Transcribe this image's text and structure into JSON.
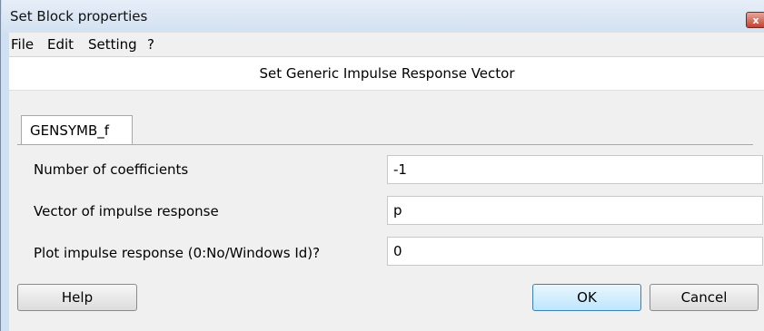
{
  "window": {
    "title": "Set Block properties",
    "close_glyph": "x"
  },
  "menu": {
    "items": [
      "File",
      "Edit",
      "Setting",
      "?"
    ]
  },
  "dialog": {
    "heading": "Set Generic Impulse Response Vector",
    "tab_label": "GENSYMB_f"
  },
  "fields": [
    {
      "label": "Number of coefficients",
      "value": "-1"
    },
    {
      "label": "Vector of impulse response",
      "value": "p"
    },
    {
      "label": "Plot impulse response (0:No/Windows Id)?",
      "value": "0"
    }
  ],
  "buttons": {
    "help": "Help",
    "ok": "OK",
    "cancel": "Cancel"
  },
  "colors": {
    "title_bar": "#d3e1f1",
    "close_button": "#c5432f",
    "ok_button_border": "#3c7fb1"
  }
}
